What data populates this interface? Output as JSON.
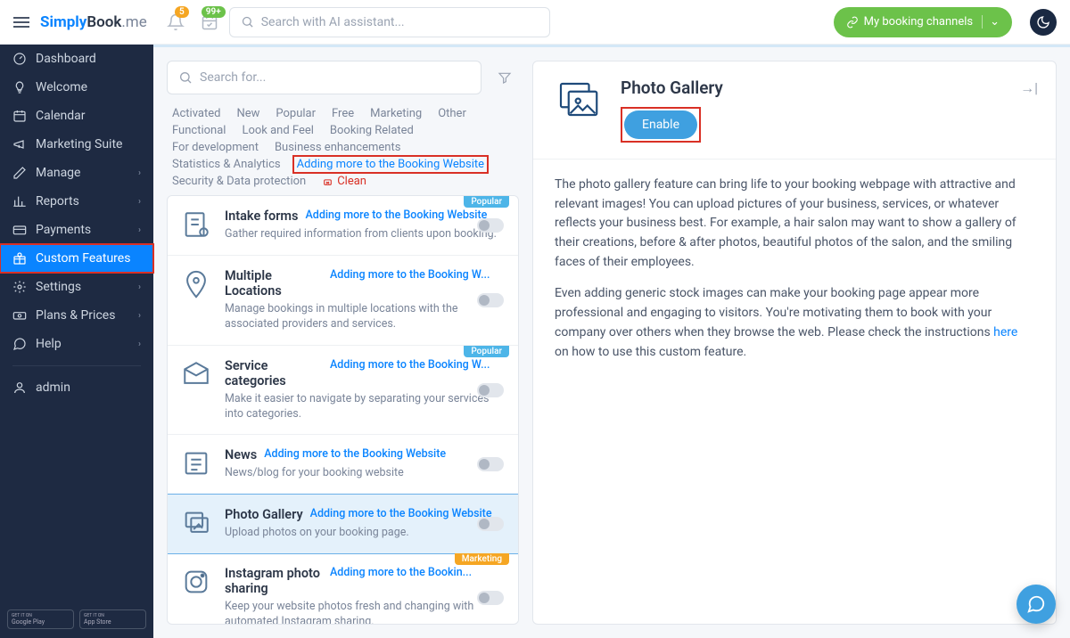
{
  "topbar": {
    "search_placeholder": "Search with AI assistant...",
    "bell_badge": "5",
    "cal_badge": "99+",
    "booking_channels": "My booking channels"
  },
  "sidebar": {
    "items": [
      {
        "label": "Dashboard",
        "icon": "gauge"
      },
      {
        "label": "Welcome",
        "icon": "bulb"
      },
      {
        "label": "Calendar",
        "icon": "calendar"
      },
      {
        "label": "Marketing Suite",
        "icon": "megaphone"
      },
      {
        "label": "Manage",
        "icon": "pencil",
        "chev": true
      },
      {
        "label": "Reports",
        "icon": "chart",
        "chev": true
      },
      {
        "label": "Payments",
        "icon": "card",
        "chev": true
      },
      {
        "label": "Custom Features",
        "icon": "gift",
        "active": true,
        "highlight": true
      },
      {
        "label": "Settings",
        "icon": "gear",
        "chev": true
      },
      {
        "label": "Plans & Prices",
        "icon": "money",
        "chev": true
      },
      {
        "label": "Help",
        "icon": "chat",
        "chev": true
      }
    ],
    "admin": "admin"
  },
  "filters": {
    "search_placeholder": "Search for...",
    "tags": [
      "Activated",
      "New",
      "Popular",
      "Free",
      "Marketing",
      "Other",
      "Functional",
      "Look and Feel",
      "Booking Related",
      "For development",
      "Business enhancements",
      "Statistics & Analytics",
      "Adding more to the Booking Website",
      "Security & Data protection"
    ],
    "active_tag": "Adding more to the Booking Website",
    "clean": "Clean"
  },
  "features": [
    {
      "title": "Intake forms",
      "cat": "Adding more to the Booking Website",
      "desc": "Gather required information from clients upon booking.",
      "badge": "Popular",
      "badge_type": "pop"
    },
    {
      "title": "Multiple Locations",
      "cat": "Adding more to the Booking W...",
      "desc": "Manage bookings in multiple locations with the associated providers and services."
    },
    {
      "title": "Service categories",
      "cat": "Adding more to the Booking W...",
      "desc": "Make it easier to navigate by separating your services into categories.",
      "badge": "Popular",
      "badge_type": "pop"
    },
    {
      "title": "News",
      "cat": "Adding more to the Booking Website",
      "desc": "News/blog for your booking website"
    },
    {
      "title": "Photo Gallery",
      "cat": "Adding more to the Booking Website",
      "desc": "Upload photos on your booking page.",
      "selected": true
    },
    {
      "title": "Instagram photo sharing",
      "cat": "Adding more to the Bookin...",
      "desc": "Keep your website photos fresh and changing with automated Instagram sharing.",
      "badge": "Marketing",
      "badge_type": "mkt"
    }
  ],
  "detail": {
    "title": "Photo Gallery",
    "enable": "Enable",
    "p1": "The photo gallery feature can bring life to your booking webpage with attractive and relevant images! You can upload pictures of your business, services, or whatever reflects your business best. For example, a hair salon may want to show a gallery of their creations, before & after photos, beautiful photos of the salon, and the smiling faces of their employees.",
    "p2a": "Even adding generic stock images can make your booking page appear more professional and engaging to visitors. You're motivating them to book with your company over others when they browse the web. Please check the instructions ",
    "p2link": "here",
    "p2b": " on how to use this custom feature."
  },
  "stores": {
    "gp_top": "GET IT ON",
    "gp": "Google Play",
    "as_top": "GET IT ON",
    "as": "App Store"
  }
}
